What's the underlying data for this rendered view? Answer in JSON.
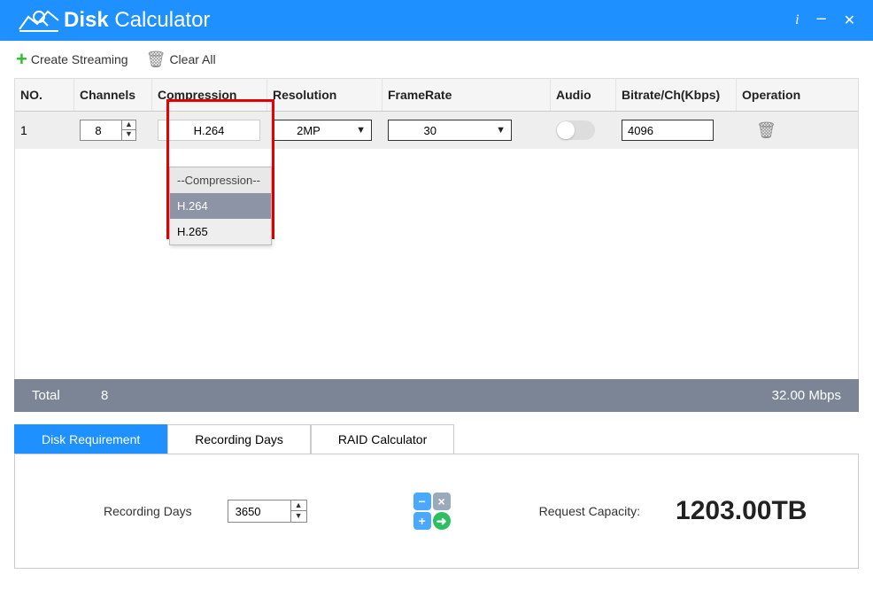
{
  "app": {
    "title_bold": "Disk",
    "title_light": " Calculator"
  },
  "toolbar": {
    "create_label": "Create Streaming",
    "clear_label": "Clear All"
  },
  "columns": {
    "no": "NO.",
    "channels": "Channels",
    "compression": "Compression",
    "resolution": "Resolution",
    "framerate": "FrameRate",
    "audio": "Audio",
    "bitrate": "Bitrate/Ch(Kbps)",
    "operation": "Operation"
  },
  "row": {
    "no": "1",
    "channels": "8",
    "compression_selected": "H.264",
    "resolution": "2MP",
    "framerate": "30",
    "bitrate": "4096"
  },
  "compression_options": {
    "header": "--Compression--",
    "opt1": "H.264",
    "opt2": "H.265"
  },
  "totals": {
    "label": "Total",
    "channels": "8",
    "bitrate": "32.00 Mbps"
  },
  "tabs": {
    "disk": "Disk Requirement",
    "days": "Recording Days",
    "raid": "RAID Calculator"
  },
  "panel": {
    "recording_days_label": "Recording Days",
    "recording_days_value": "3650",
    "request_label": "Request Capacity:",
    "capacity": "1203.00TB"
  }
}
